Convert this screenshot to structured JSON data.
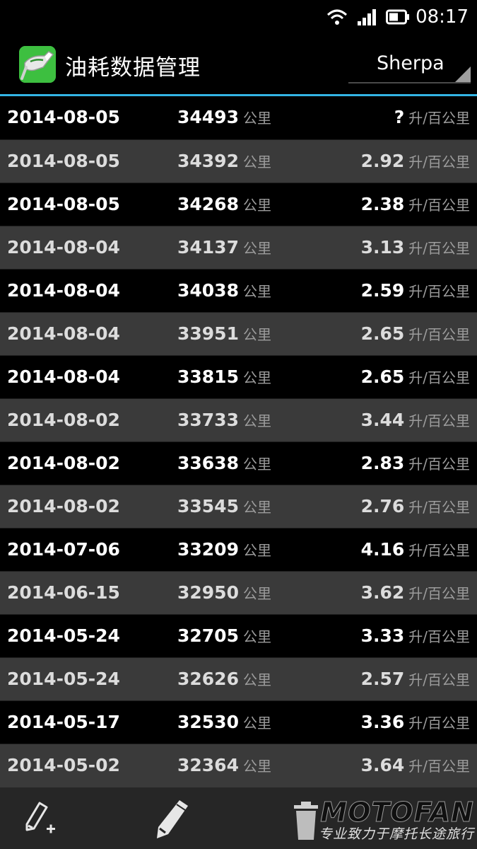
{
  "status_bar": {
    "time": "08:17"
  },
  "app": {
    "title": "油耗数据管理",
    "vehicle_selected": "Sherpa"
  },
  "units": {
    "distance": "公里",
    "consumption": "升/百公里"
  },
  "records": [
    {
      "date": "2014-08-05",
      "odometer": "34493",
      "consumption": "?"
    },
    {
      "date": "2014-08-05",
      "odometer": "34392",
      "consumption": "2.92"
    },
    {
      "date": "2014-08-05",
      "odometer": "34268",
      "consumption": "2.38"
    },
    {
      "date": "2014-08-04",
      "odometer": "34137",
      "consumption": "3.13"
    },
    {
      "date": "2014-08-04",
      "odometer": "34038",
      "consumption": "2.59"
    },
    {
      "date": "2014-08-04",
      "odometer": "33951",
      "consumption": "2.65"
    },
    {
      "date": "2014-08-04",
      "odometer": "33815",
      "consumption": "2.65"
    },
    {
      "date": "2014-08-02",
      "odometer": "33733",
      "consumption": "3.44"
    },
    {
      "date": "2014-08-02",
      "odometer": "33638",
      "consumption": "2.83"
    },
    {
      "date": "2014-08-02",
      "odometer": "33545",
      "consumption": "2.76"
    },
    {
      "date": "2014-07-06",
      "odometer": "33209",
      "consumption": "4.16"
    },
    {
      "date": "2014-06-15",
      "odometer": "32950",
      "consumption": "3.62"
    },
    {
      "date": "2014-05-24",
      "odometer": "32705",
      "consumption": "3.33"
    },
    {
      "date": "2014-05-24",
      "odometer": "32626",
      "consumption": "2.57"
    },
    {
      "date": "2014-05-17",
      "odometer": "32530",
      "consumption": "3.36"
    },
    {
      "date": "2014-05-02",
      "odometer": "32364",
      "consumption": "3.64"
    }
  ],
  "bottom_bar": {
    "actions": [
      "add-record",
      "edit-record",
      "delete-record"
    ]
  },
  "watermark": {
    "brand": "MOTOFAN",
    "tagline": "专业致力于摩托长途旅行"
  },
  "colors": {
    "accent": "#33b5e5",
    "row_alt": "#3a3a3a",
    "app_icon": "#3dbf40"
  }
}
